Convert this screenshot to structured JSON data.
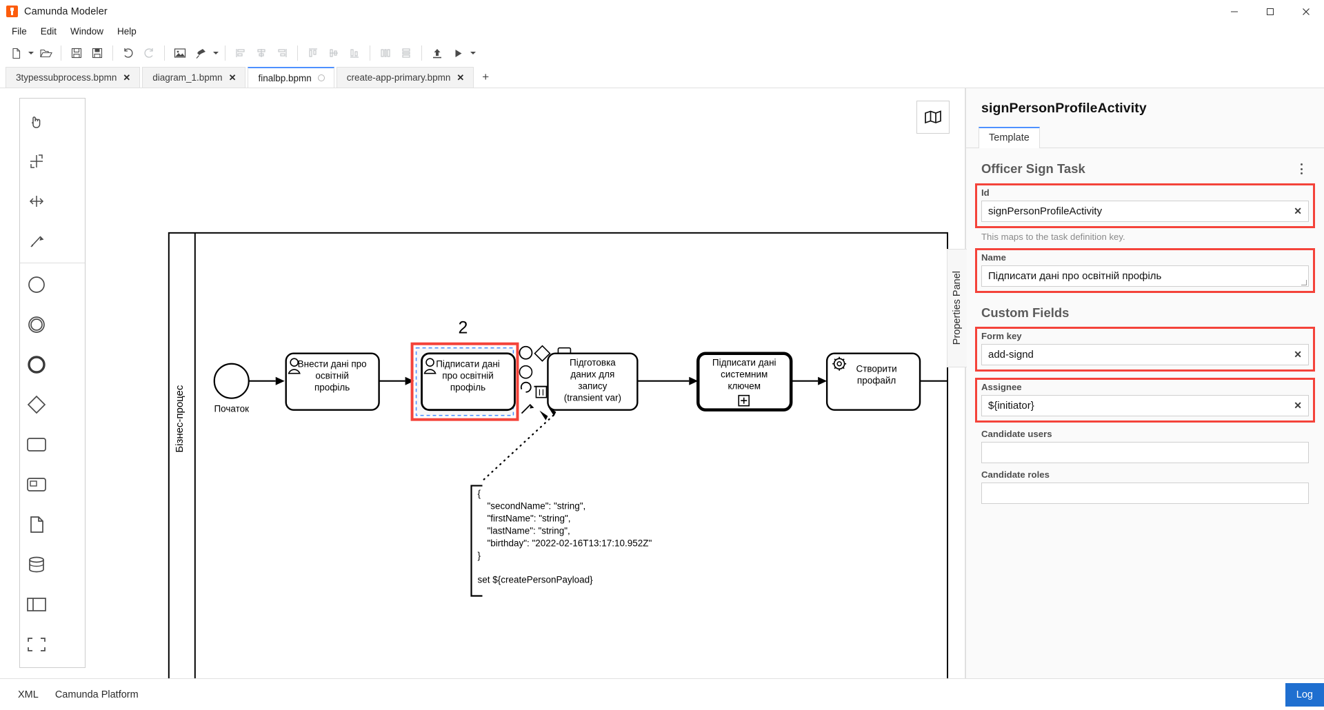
{
  "window": {
    "app_title": "Camunda Modeler",
    "logo_icon": "camunda-logo-icon",
    "minimize_label": "minimize-icon",
    "maximize_label": "maximize-icon",
    "close_label": "close-icon"
  },
  "menu": {
    "items": [
      {
        "label": "File"
      },
      {
        "label": "Edit"
      },
      {
        "label": "Window"
      },
      {
        "label": "Help"
      }
    ]
  },
  "toolbar": {
    "buttons": [
      {
        "name": "new-diagram-icon",
        "title": "New diagram",
        "enabled": true
      },
      {
        "name": "open-file-icon",
        "title": "Open file",
        "enabled": true
      },
      {
        "name": "save-icon",
        "title": "Save",
        "enabled": true
      },
      {
        "name": "save-as-icon",
        "title": "Save as",
        "enabled": true
      },
      {
        "name": "undo-icon",
        "title": "Undo",
        "enabled": true
      },
      {
        "name": "redo-icon",
        "title": "Redo",
        "enabled": true
      },
      {
        "name": "export-image-icon",
        "title": "Export as image",
        "enabled": true
      },
      {
        "name": "brush-icon",
        "title": "Set color",
        "enabled": true
      },
      {
        "name": "align-left-icon",
        "title": "Align left",
        "enabled": false
      },
      {
        "name": "align-center-icon",
        "title": "Align center",
        "enabled": false
      },
      {
        "name": "align-right-icon",
        "title": "Align right",
        "enabled": false
      },
      {
        "name": "align-top-icon",
        "title": "Align top",
        "enabled": false
      },
      {
        "name": "align-middle-icon",
        "title": "Align middle",
        "enabled": false
      },
      {
        "name": "align-bottom-icon",
        "title": "Align bottom",
        "enabled": false
      },
      {
        "name": "distribute-horizontal-icon",
        "title": "Distribute horizontally",
        "enabled": false
      },
      {
        "name": "distribute-vertical-icon",
        "title": "Distribute vertically",
        "enabled": false
      },
      {
        "name": "deploy-icon",
        "title": "Deploy current diagram",
        "enabled": true
      },
      {
        "name": "run-icon",
        "title": "Start current diagram",
        "enabled": true
      }
    ]
  },
  "tabs": {
    "items": [
      {
        "label": "3typessubprocess.bpmn",
        "active": false,
        "dirty": false,
        "close_glyph": "✕"
      },
      {
        "label": "diagram_1.bpmn",
        "active": false,
        "dirty": false,
        "close_glyph": "✕"
      },
      {
        "label": "finalbp.bpmn",
        "active": true,
        "dirty": true,
        "close_glyph": "✕"
      },
      {
        "label": "create-app-primary.bpmn",
        "active": false,
        "dirty": false,
        "close_glyph": "✕"
      }
    ],
    "add_label": "+"
  },
  "canvas": {
    "minimap_icon": "map-icon",
    "palette": [
      {
        "name": "hand-tool-icon"
      },
      {
        "name": "lasso-tool-icon"
      },
      {
        "name": "space-tool-icon"
      },
      {
        "name": "connect-tool-icon"
      },
      {
        "name": "start-event-icon"
      },
      {
        "name": "intermediate-event-icon"
      },
      {
        "name": "end-event-icon"
      },
      {
        "name": "gateway-icon"
      },
      {
        "name": "task-icon"
      },
      {
        "name": "subprocess-icon"
      },
      {
        "name": "data-object-icon"
      },
      {
        "name": "data-store-icon"
      },
      {
        "name": "participant-icon"
      },
      {
        "name": "group-icon"
      }
    ],
    "pool_label": "Бізнес-процес",
    "annotation_number": "2",
    "elements": {
      "start_event_label": "Початок",
      "task1_label": "Внести дані про освітній профіль",
      "task2_label": "Підписати дані про освітній профіль",
      "task3_label": "Підготовка даних для запису (transient var)",
      "task4_label": "Підписати дані системним ключем",
      "task5_label": "Створити профайл"
    },
    "text_annotation": {
      "lines": [
        "{",
        "    \"secondName\": \"string\",",
        "    \"firstName\": \"string\",",
        "    \"lastName\": \"string\",",
        "    \"birthday\": \"2022-02-16T13:17:10.952Z\"",
        "}",
        "",
        "set ${createPersonPayload}"
      ]
    },
    "context_pad": [
      {
        "name": "append-end-event-icon"
      },
      {
        "name": "append-gateway-icon"
      },
      {
        "name": "append-task-icon"
      },
      {
        "name": "append-intermediate-event-icon"
      },
      {
        "name": "change-type-icon"
      },
      {
        "name": "delete-icon"
      },
      {
        "name": "connect-icon"
      }
    ]
  },
  "properties": {
    "title": "signPersonProfileActivity",
    "tab_label": "Template",
    "handle_label": "Properties Panel",
    "group_title": "Officer Sign Task",
    "menu_icon": "kebab-menu-icon",
    "fields": [
      {
        "label": "Id",
        "value": "signPersonProfileActivity",
        "placeholder": "",
        "hint": "This maps to the task definition key.",
        "highlighted": true,
        "clearable": true,
        "type": "text"
      },
      {
        "label": "Name",
        "value": "Підписати дані про освітній профіль",
        "placeholder": "",
        "hint": "",
        "highlighted": true,
        "clearable": false,
        "type": "textarea"
      }
    ],
    "custom_fields_title": "Custom Fields",
    "custom_fields": [
      {
        "label": "Form key",
        "value": "add-signd",
        "placeholder": "",
        "highlighted": true,
        "clearable": true,
        "type": "text"
      },
      {
        "label": "Assignee",
        "value": "${initiator}",
        "placeholder": "",
        "highlighted": true,
        "clearable": true,
        "type": "text"
      },
      {
        "label": "Candidate users",
        "value": "",
        "placeholder": "",
        "highlighted": false,
        "clearable": false,
        "type": "text"
      },
      {
        "label": "Candidate roles",
        "value": "",
        "placeholder": "",
        "highlighted": false,
        "clearable": false,
        "type": "text"
      }
    ],
    "clear_glyph": "✕"
  },
  "statusbar": {
    "xml_label": "XML",
    "platform_label": "Camunda Platform",
    "log_label": "Log"
  },
  "colors": {
    "accent_blue": "#4d90ff",
    "highlight_red": "#f4433a",
    "brand_orange": "#fc5d0d",
    "log_blue": "#1f6fd0"
  }
}
